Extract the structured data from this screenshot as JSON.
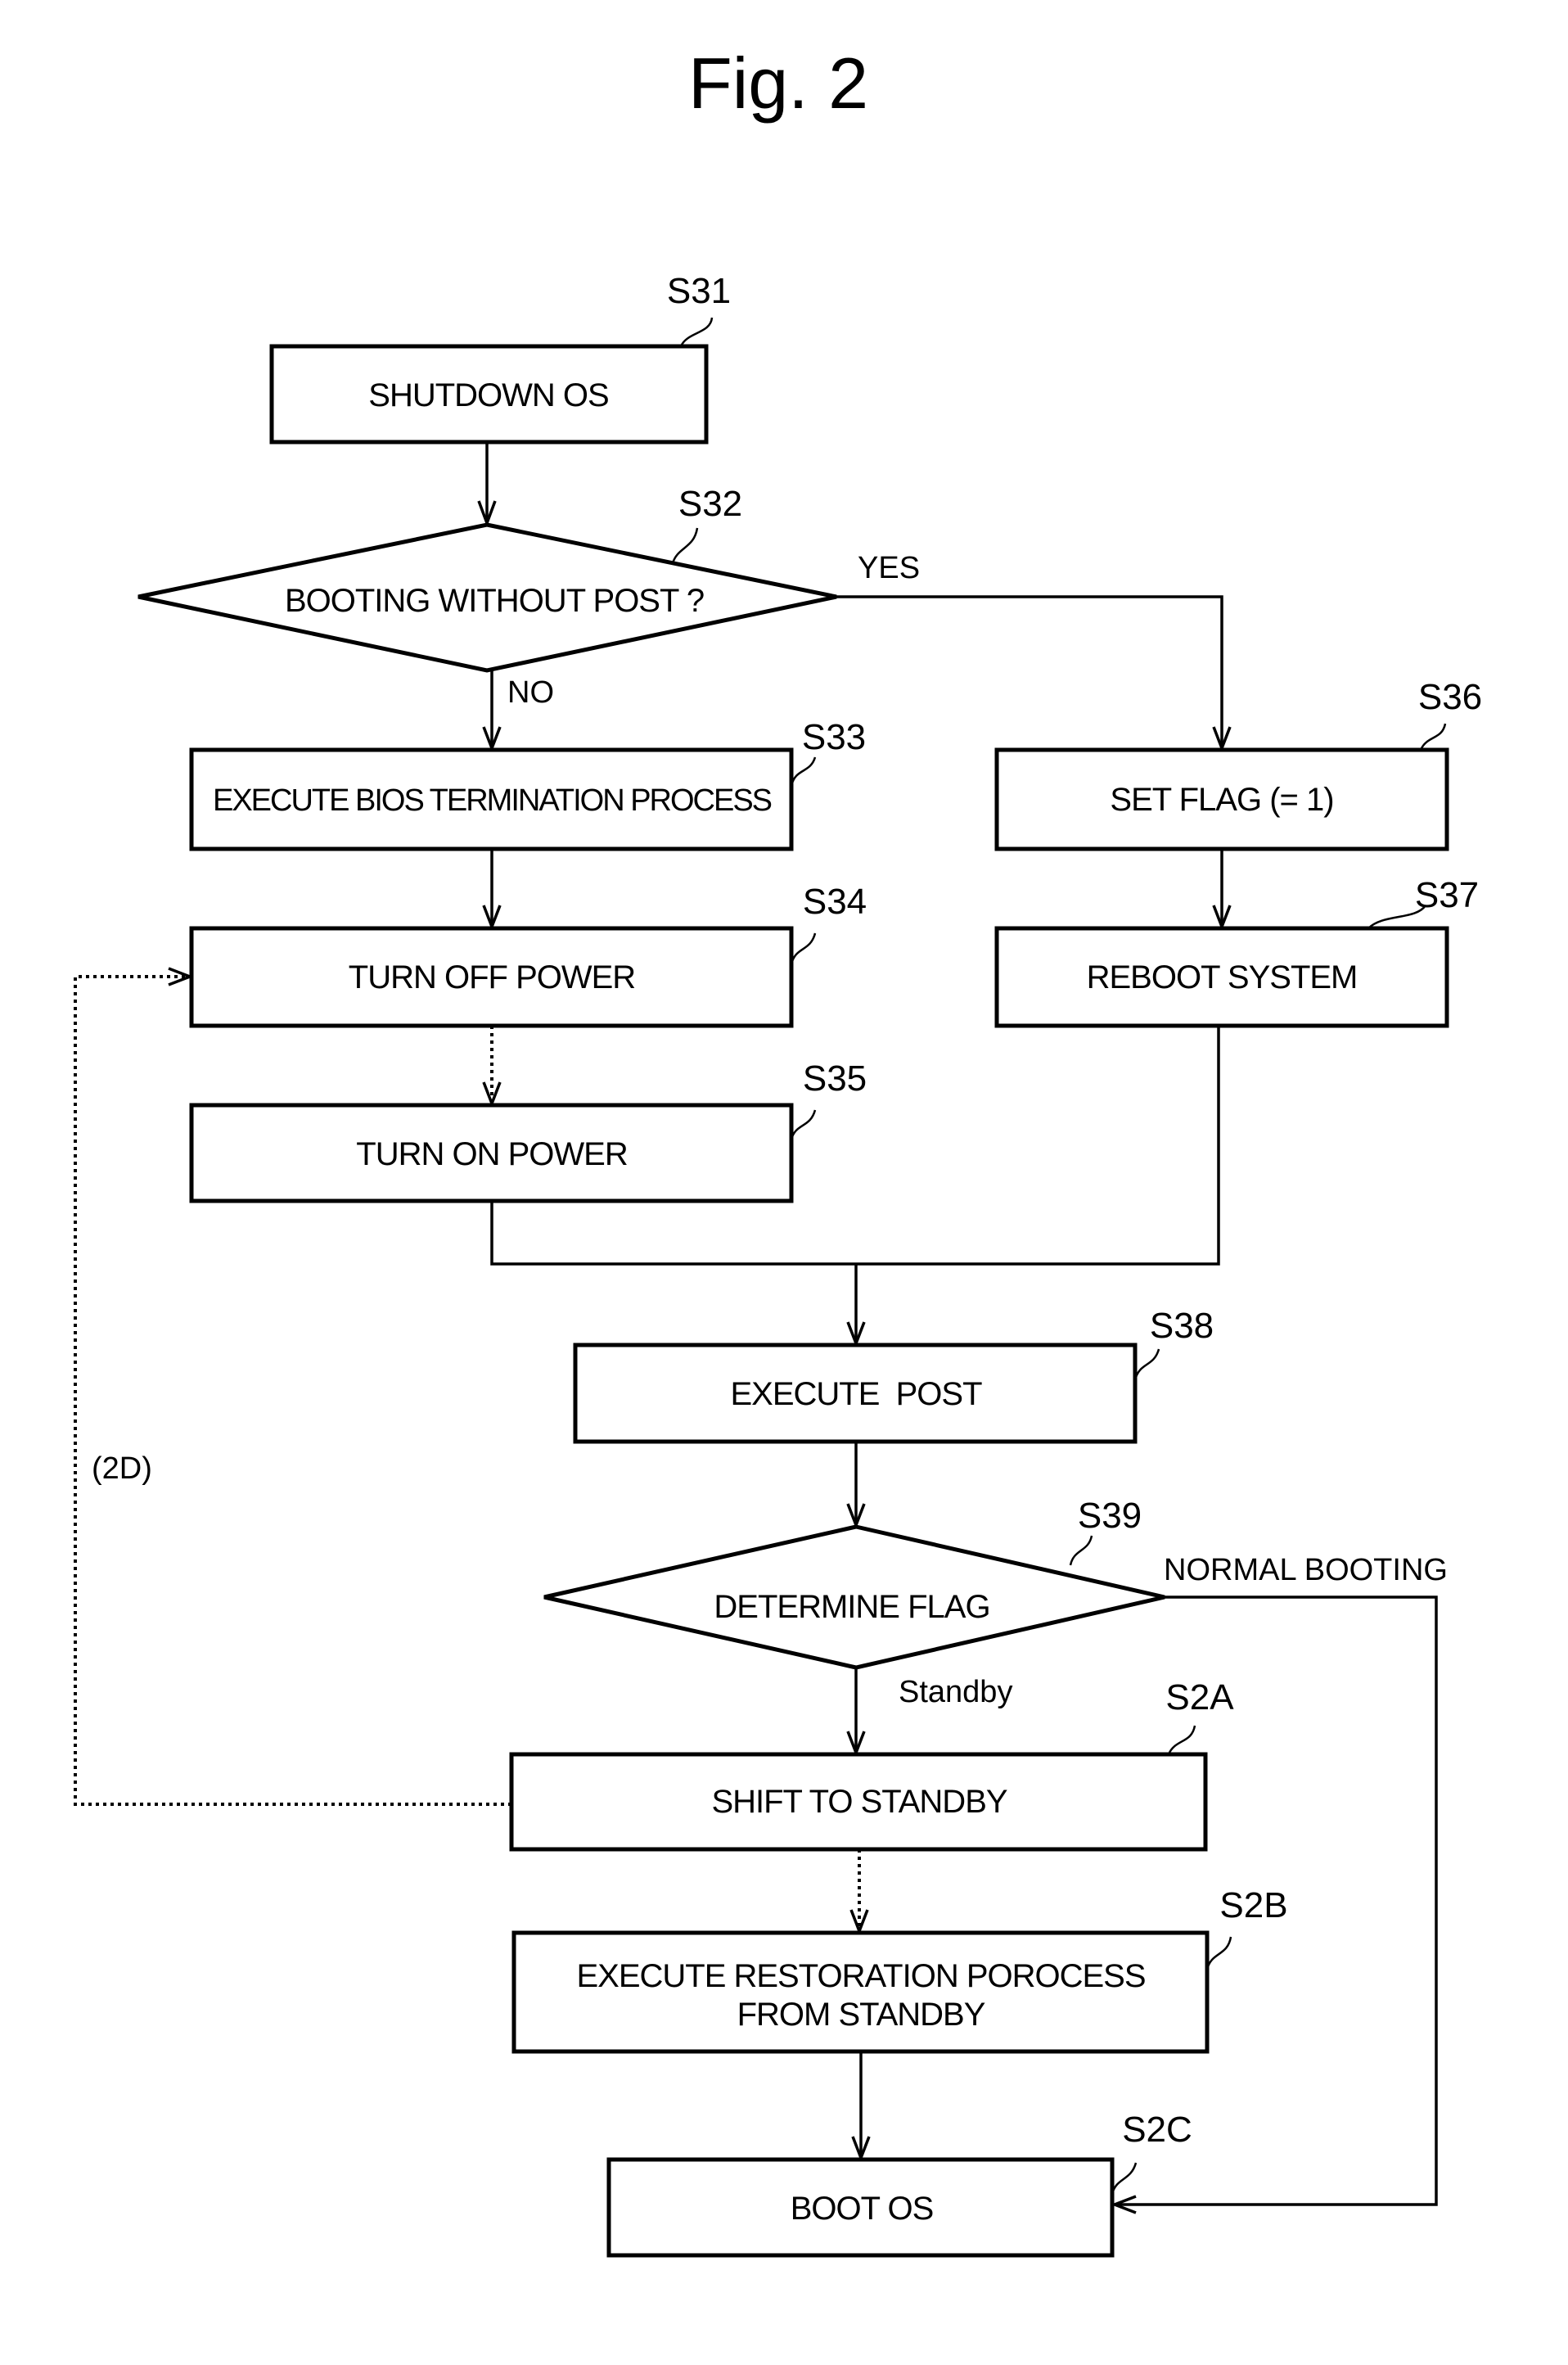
{
  "figure": {
    "title": "Fig. 2"
  },
  "steps": {
    "s31": {
      "id": "S31",
      "label": "SHUTDOWN OS",
      "type": "process"
    },
    "s32": {
      "id": "S32",
      "label": "BOOTING WITHOUT POST ?",
      "type": "decision"
    },
    "s33": {
      "id": "S33",
      "label": "EXECUTE BIOS TERMINATION PROCESS",
      "type": "process"
    },
    "s34": {
      "id": "S34",
      "label": "TURN OFF POWER",
      "type": "process"
    },
    "s35": {
      "id": "S35",
      "label": "TURN ON POWER",
      "type": "process"
    },
    "s36": {
      "id": "S36",
      "label": "SET FLAG (= 1)",
      "type": "process"
    },
    "s37": {
      "id": "S37",
      "label": "REBOOT SYSTEM",
      "type": "process"
    },
    "s38": {
      "id": "S38",
      "label": "EXECUTE  POST",
      "type": "process"
    },
    "s39": {
      "id": "S39",
      "label": "DETERMINE FLAG",
      "type": "decision"
    },
    "s2a": {
      "id": "S2A",
      "label": "SHIFT TO STANDBY",
      "type": "process"
    },
    "s2b": {
      "id": "S2B",
      "label_line1": "EXECUTE RESTORATION POROCESS",
      "label_line2": "FROM STANDBY",
      "type": "process"
    },
    "s2c": {
      "id": "S2C",
      "label": "BOOT OS",
      "type": "process"
    }
  },
  "branches": {
    "s32_yes": "YES",
    "s32_no": "NO",
    "s39_normal": "NORMAL BOOTING",
    "s39_standby": "Standby",
    "loop_2d": "(2D)"
  },
  "edges": [
    {
      "from": "S31",
      "to": "S32",
      "style": "solid"
    },
    {
      "from": "S32",
      "to": "S33",
      "label": "NO",
      "style": "solid"
    },
    {
      "from": "S32",
      "to": "S36",
      "label": "YES",
      "style": "solid"
    },
    {
      "from": "S33",
      "to": "S34",
      "style": "solid"
    },
    {
      "from": "S34",
      "to": "S35",
      "style": "dotted"
    },
    {
      "from": "S36",
      "to": "S37",
      "style": "solid"
    },
    {
      "from": "S35",
      "to": "S38",
      "style": "solid"
    },
    {
      "from": "S37",
      "to": "S38",
      "style": "solid"
    },
    {
      "from": "S38",
      "to": "S39",
      "style": "solid"
    },
    {
      "from": "S39",
      "to": "S2A",
      "label": "Standby",
      "style": "solid"
    },
    {
      "from": "S39",
      "to": "S2C",
      "label": "NORMAL BOOTING",
      "style": "solid"
    },
    {
      "from": "S2A",
      "to": "S34",
      "label": "(2D)",
      "style": "dotted"
    },
    {
      "from": "S2A",
      "to": "S2B",
      "style": "dotted"
    },
    {
      "from": "S2B",
      "to": "S2C",
      "style": "solid"
    }
  ]
}
